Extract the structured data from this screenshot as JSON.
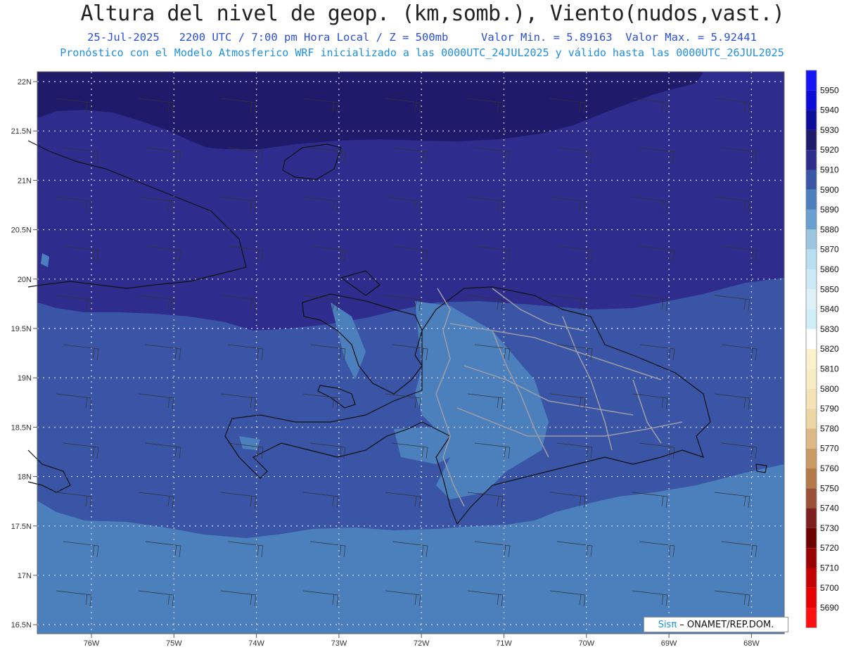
{
  "header": {
    "title": "Altura del nivel de geop. (km,somb.), Viento(nudos,vast.)",
    "subtitle": "25-Jul-2025   2200 UTC / 7:00 pm Hora Local / Z = 500mb     Valor Min. = 5.89163  Valor Max. = 5.92441",
    "info": "Pronóstico con el Modelo Atmosferico WRF inicializado a las 0000UTC_24JUL2025 y válido hasta las  0000UTC_26JUL2025"
  },
  "axes": {
    "lat_labels": [
      "22N",
      "21.5N",
      "21N",
      "20.5N",
      "20N",
      "19.5N",
      "19N",
      "18.5N",
      "18N",
      "17.5N",
      "17N",
      "16.5N"
    ],
    "lon_labels": [
      "76W",
      "75W",
      "74W",
      "73W",
      "72W",
      "71W",
      "70W",
      "69W",
      "68W"
    ]
  },
  "colorbar": {
    "levels": [
      {
        "value": "5950",
        "color": "#1515f5"
      },
      {
        "value": "5940",
        "color": "#0c0cd6"
      },
      {
        "value": "5930",
        "color": "#0d0d9a"
      },
      {
        "value": "5920",
        "color": "#201a6a"
      },
      {
        "value": "5910",
        "color": "#2e2c8c"
      },
      {
        "value": "5900",
        "color": "#3a54a6"
      },
      {
        "value": "5890",
        "color": "#4c80bd"
      },
      {
        "value": "5880",
        "color": "#6aa0d0"
      },
      {
        "value": "5870",
        "color": "#9cc6e0"
      },
      {
        "value": "5860",
        "color": "#b9def0"
      },
      {
        "value": "5850",
        "color": "#cde9f5"
      },
      {
        "value": "5840",
        "color": "#dff1f8"
      },
      {
        "value": "5830",
        "color": "#cfeef8"
      },
      {
        "value": "5820",
        "color": "#ffffff"
      },
      {
        "value": "5810",
        "color": "#fbf2cc"
      },
      {
        "value": "5800",
        "color": "#f8ecc4"
      },
      {
        "value": "5790",
        "color": "#f3e3b6"
      },
      {
        "value": "5780",
        "color": "#ecd6a3"
      },
      {
        "value": "5770",
        "color": "#dcb986"
      },
      {
        "value": "5760",
        "color": "#c99a62"
      },
      {
        "value": "5750",
        "color": "#b57a4a"
      },
      {
        "value": "5740",
        "color": "#9a5038"
      },
      {
        "value": "5730",
        "color": "#7d1f20"
      },
      {
        "value": "5720",
        "color": "#6d0000"
      },
      {
        "value": "5710",
        "color": "#9a0000"
      },
      {
        "value": "5700",
        "color": "#c40000"
      },
      {
        "value": "5690",
        "color": "#e60000"
      },
      {
        "value": "",
        "color": "#ff1010"
      }
    ]
  },
  "shading": {
    "color_5920": "#201a6a",
    "color_5910": "#2e2c8c",
    "color_5900": "#3a54a6",
    "color_5890": "#4c80bd"
  },
  "credit": {
    "sis": "Sisπ",
    "org": " – ONAMET/REP.DOM."
  }
}
